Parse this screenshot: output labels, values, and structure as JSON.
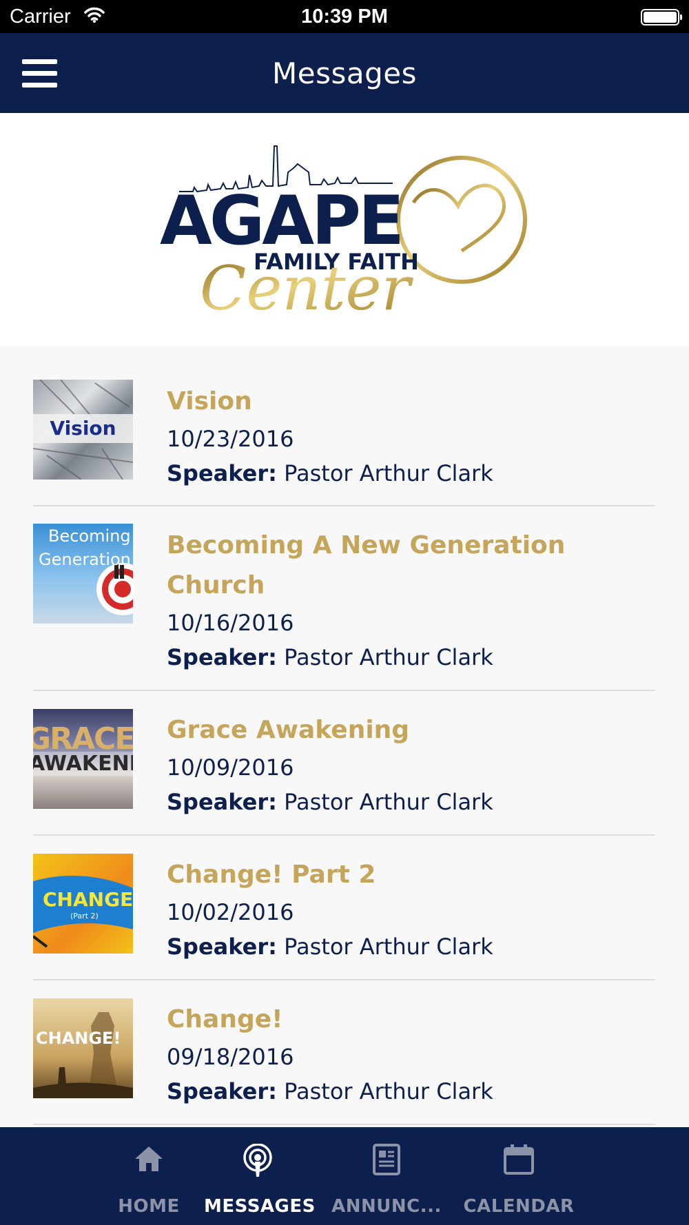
{
  "status_bar": {
    "carrier": "Carrier",
    "time": "10:39 PM"
  },
  "nav": {
    "title": "Messages"
  },
  "logo": {
    "line1": "AGAPE",
    "line2": "FAMILY FAITH",
    "line3": "Center"
  },
  "messages": [
    {
      "title": "Vision",
      "date": "10/23/2016",
      "speaker_label": "Speaker:",
      "speaker": "Pastor Arthur Clark",
      "thumb_text": "Vision"
    },
    {
      "title": "Becoming A New Generation Church",
      "date": "10/16/2016",
      "speaker_label": "Speaker:",
      "speaker": "Pastor Arthur Clark",
      "thumb_text": "Becoming",
      "thumb_text2": "Generation"
    },
    {
      "title": "Grace Awakening",
      "date": "10/09/2016",
      "speaker_label": "Speaker:",
      "speaker": "Pastor Arthur Clark",
      "thumb_text": "GRACE",
      "thumb_text2": "AWAKENI"
    },
    {
      "title": "Change! Part 2",
      "date": "10/02/2016",
      "speaker_label": "Speaker:",
      "speaker": "Pastor Arthur Clark",
      "thumb_text": "CHANGE",
      "thumb_text2": "(Part 2)"
    },
    {
      "title": "Change!",
      "date": "09/18/2016",
      "speaker_label": "Speaker:",
      "speaker": "Pastor Arthur Clark",
      "thumb_text": "CHANGE!"
    }
  ],
  "tabs": [
    {
      "label": "HOME",
      "icon": "home-icon",
      "active": false
    },
    {
      "label": "MESSAGES",
      "icon": "podcast-icon",
      "active": true
    },
    {
      "label": "ANNUNC...",
      "icon": "newspaper-icon",
      "active": false
    },
    {
      "label": "CALENDAR",
      "icon": "calendar-icon",
      "active": false
    }
  ],
  "colors": {
    "navy": "#0d1f4d",
    "gold": "#c5a55a",
    "inactive_tab": "#8c93a8"
  }
}
